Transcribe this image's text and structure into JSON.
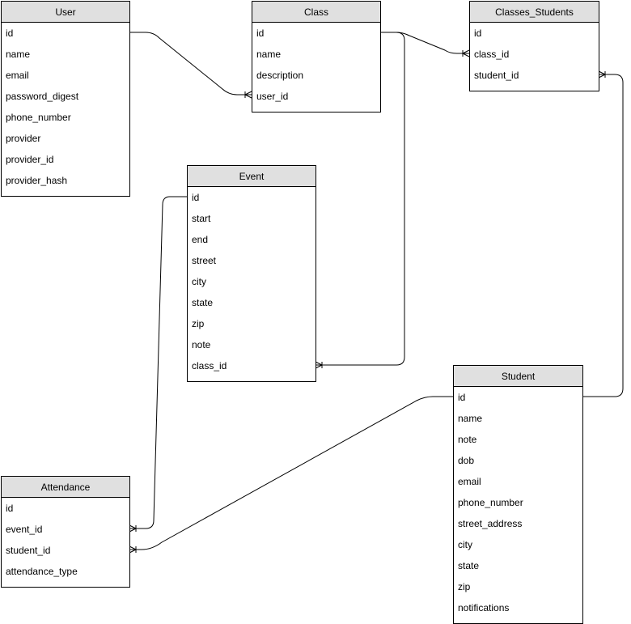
{
  "entities": [
    {
      "key": "user",
      "name": "User",
      "fields": [
        "id",
        "name",
        "email",
        "password_digest",
        "phone_number",
        "provider",
        "provider_id",
        "provider_hash"
      ]
    },
    {
      "key": "class",
      "name": "Class",
      "fields": [
        "id",
        "name",
        "description",
        "user_id"
      ]
    },
    {
      "key": "classes_students",
      "name": "Classes_Students",
      "fields": [
        "id",
        "class_id",
        "student_id"
      ]
    },
    {
      "key": "event",
      "name": "Event",
      "fields": [
        "id",
        "start",
        "end",
        "street",
        "city",
        "state",
        "zip",
        "note",
        "class_id"
      ]
    },
    {
      "key": "student",
      "name": "Student",
      "fields": [
        "id",
        "name",
        "note",
        "dob",
        "email",
        "phone_number",
        "street_address",
        "city",
        "state",
        "zip",
        "notifications"
      ]
    },
    {
      "key": "attendance",
      "name": "Attendance",
      "fields": [
        "id",
        "event_id",
        "student_id",
        "attendance_type"
      ]
    }
  ],
  "relationships": [
    {
      "from": "User.id",
      "to": "Class.user_id",
      "cardinality": "one-to-many"
    },
    {
      "from": "Class.id",
      "to": "Classes_Students.class_id",
      "cardinality": "one-to-many"
    },
    {
      "from": "Class.id",
      "to": "Event.class_id",
      "cardinality": "one-to-many"
    },
    {
      "from": "Student.id",
      "to": "Classes_Students.student_id",
      "cardinality": "one-to-many"
    },
    {
      "from": "Event.id",
      "to": "Attendance.event_id",
      "cardinality": "one-to-many"
    },
    {
      "from": "Student.id",
      "to": "Attendance.student_id",
      "cardinality": "one-to-many"
    }
  ]
}
